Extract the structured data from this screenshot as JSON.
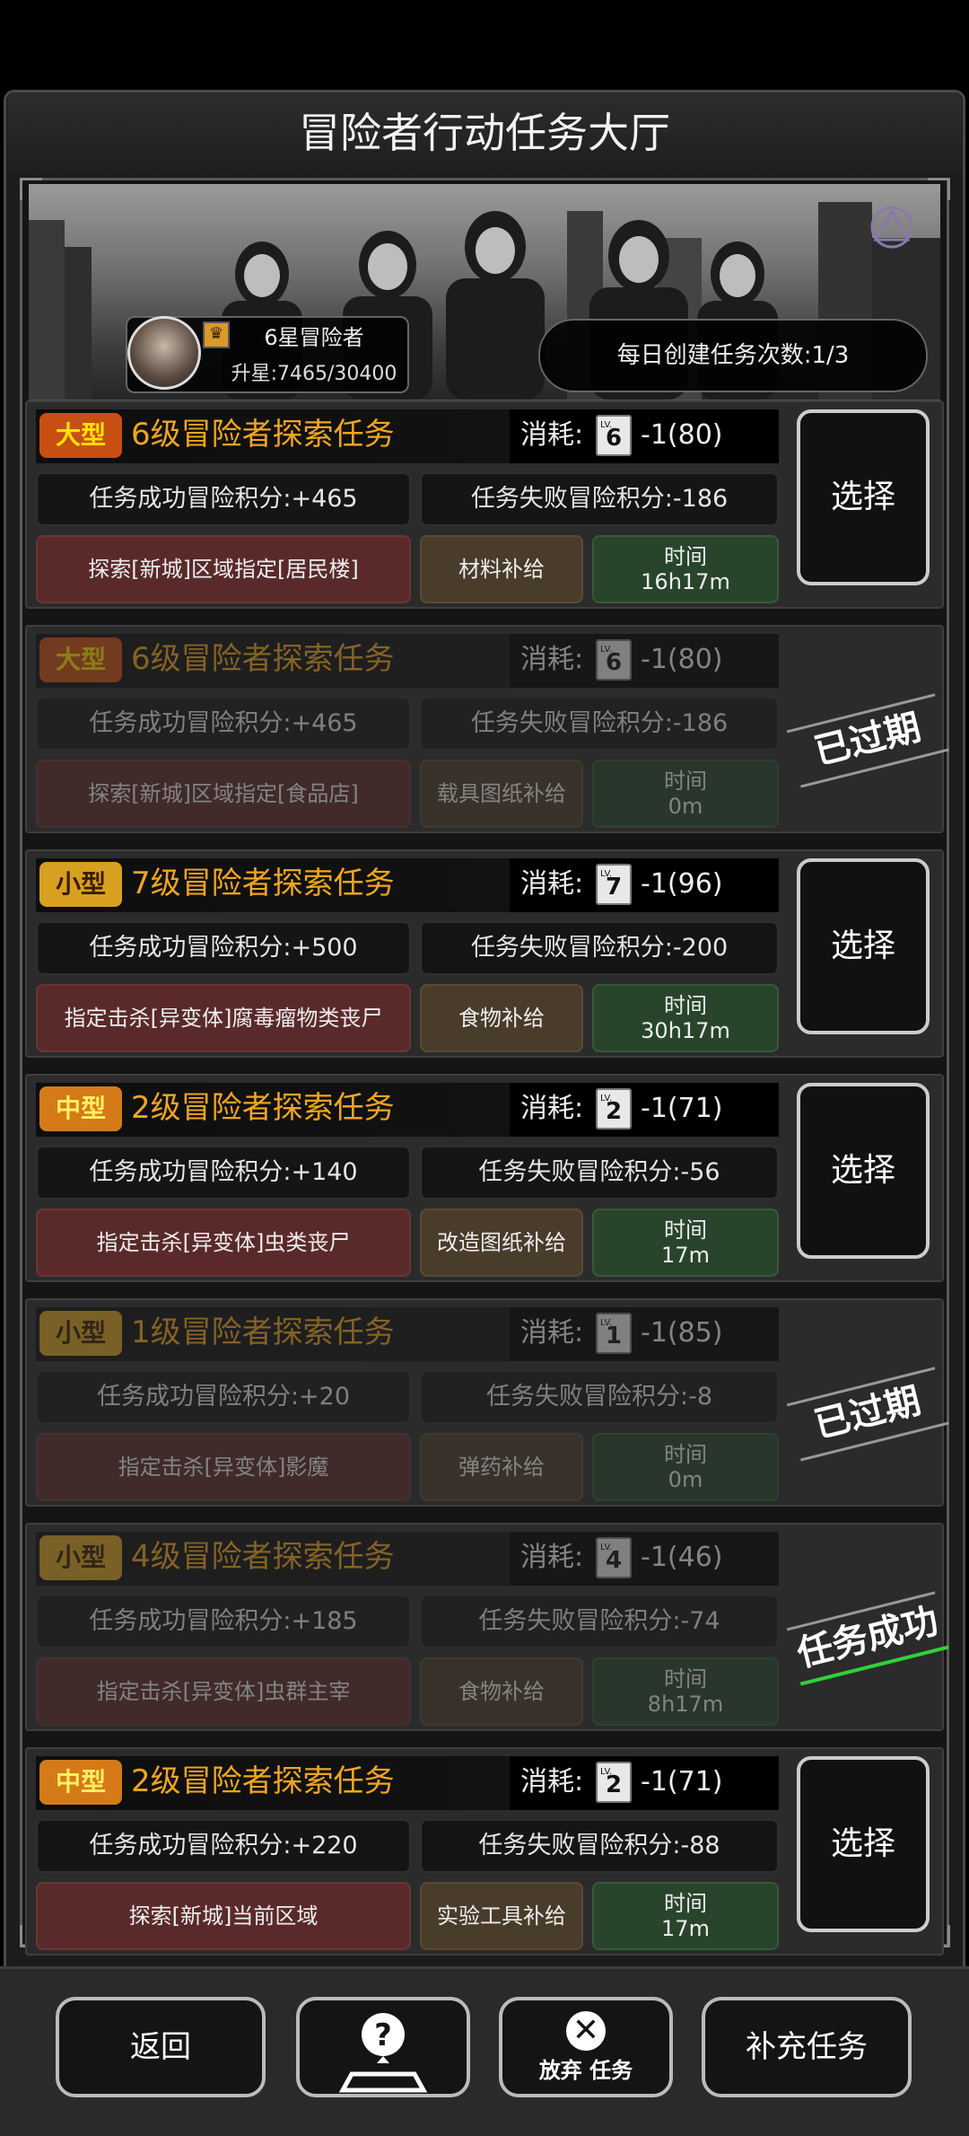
{
  "title": "冒险者行动任务大厅",
  "rank": {
    "name": "6星冒险者",
    "exp_label": "升星:7465/30400"
  },
  "daily": "每日创建任务次数:1/3",
  "cost_label": "消耗:",
  "lv_text": "LV.",
  "tasks": [
    {
      "size": "大型",
      "title": "6级冒险者探索任务",
      "cost_lv": "6",
      "cost": "-1(80)",
      "success": "任务成功冒险积分:+465",
      "fail": "任务失败冒险积分:-186",
      "objective": "探索[新城]区域指定[居民楼]",
      "reward": "材料补给",
      "time_label": "时间",
      "time": "16h17m",
      "action": "选择"
    },
    {
      "size": "大型",
      "title": "6级冒险者探索任务",
      "cost_lv": "6",
      "cost": "-1(80)",
      "success": "任务成功冒险积分:+465",
      "fail": "任务失败冒险积分:-186",
      "objective": "探索[新城]区域指定[食品店]",
      "reward": "载具图纸补给",
      "time_label": "时间",
      "time": "0m",
      "status": "已过期"
    },
    {
      "size": "小型",
      "title": "7级冒险者探索任务",
      "cost_lv": "7",
      "cost": "-1(96)",
      "success": "任务成功冒险积分:+500",
      "fail": "任务失败冒险积分:-200",
      "objective": "指定击杀[异变体]腐毒瘤物类丧尸",
      "reward": "食物补给",
      "time_label": "时间",
      "time": "30h17m",
      "action": "选择"
    },
    {
      "size": "中型",
      "title": "2级冒险者探索任务",
      "cost_lv": "2",
      "cost": "-1(71)",
      "success": "任务成功冒险积分:+140",
      "fail": "任务失败冒险积分:-56",
      "objective": "指定击杀[异变体]虫类丧尸",
      "reward": "改造图纸补给",
      "time_label": "时间",
      "time": "17m",
      "action": "选择"
    },
    {
      "size": "小型",
      "title": "1级冒险者探索任务",
      "cost_lv": "1",
      "cost": "-1(85)",
      "success": "任务成功冒险积分:+20",
      "fail": "任务失败冒险积分:-8",
      "objective": "指定击杀[异变体]影魔",
      "reward": "弹药补给",
      "time_label": "时间",
      "time": "0m",
      "status": "已过期"
    },
    {
      "size": "小型",
      "title": "4级冒险者探索任务",
      "cost_lv": "4",
      "cost": "-1(46)",
      "success": "任务成功冒险积分:+185",
      "fail": "任务失败冒险积分:-74",
      "objective": "指定击杀[异变体]虫群主宰",
      "reward": "食物补给",
      "time_label": "时间",
      "time": "8h17m",
      "status": "任务成功"
    },
    {
      "size": "中型",
      "title": "2级冒险者探索任务",
      "cost_lv": "2",
      "cost": "-1(71)",
      "success": "任务成功冒险积分:+220",
      "fail": "任务失败冒险积分:-88",
      "objective": "探索[新城]当前区域",
      "reward": "实验工具补给",
      "time_label": "时间",
      "time": "17m",
      "action": "选择"
    }
  ],
  "bottom": {
    "back": "返回",
    "help_icon": "question-map-icon",
    "abandon": "放弃 任务",
    "refill": "补充任务"
  }
}
